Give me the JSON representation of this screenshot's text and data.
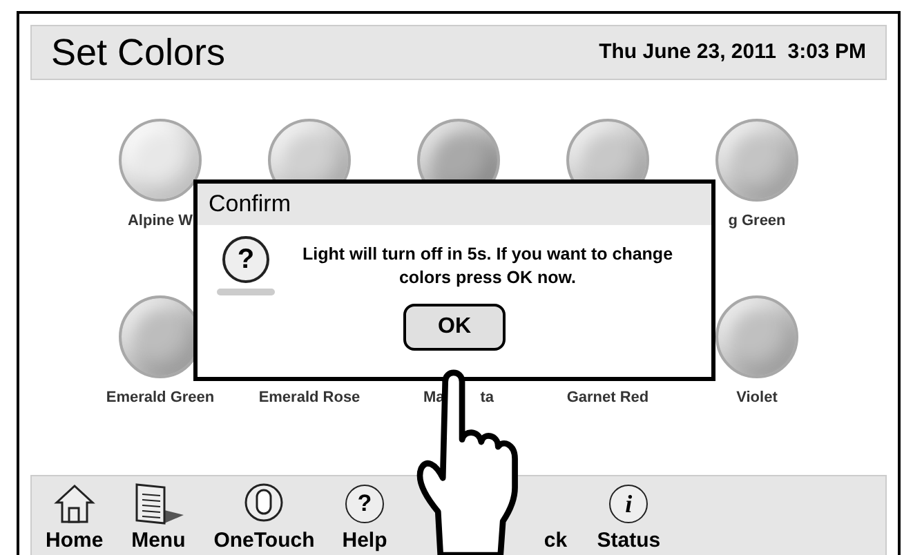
{
  "header": {
    "title": "Set Colors",
    "datetime": "Thu June 23, 2011  3:03 PM"
  },
  "colors": [
    {
      "label": "Alpine W",
      "color": "#e8e8e8"
    },
    {
      "color": "#d0d0d0"
    },
    {
      "color": "#a9a9a9"
    },
    {
      "color": "#c8c8c8"
    },
    {
      "label": "g Green",
      "color": "#c4c4c4"
    },
    {
      "label": "Emerald Green",
      "color": "#bdbdbd"
    },
    {
      "label": "Emerald Rose"
    },
    {
      "label": "Ma",
      "label_tail": "ta"
    },
    {
      "label": "Garnet Red"
    },
    {
      "label": "Violet",
      "color": "#c0c0c0"
    }
  ],
  "dialog": {
    "title": "Confirm",
    "icon": "?",
    "message": "Light will turn off in 5s. If you want to change colors press OK now.",
    "button": "OK"
  },
  "toolbar": [
    {
      "kind": "home",
      "label": "Home"
    },
    {
      "kind": "menu",
      "label": "Menu"
    },
    {
      "kind": "onetouch",
      "label": "OneTouch"
    },
    {
      "kind": "help",
      "icon": "?",
      "label": "Help"
    },
    {
      "kind": "back",
      "label": "ck"
    },
    {
      "kind": "status",
      "icon": "i",
      "label": "Status"
    }
  ]
}
